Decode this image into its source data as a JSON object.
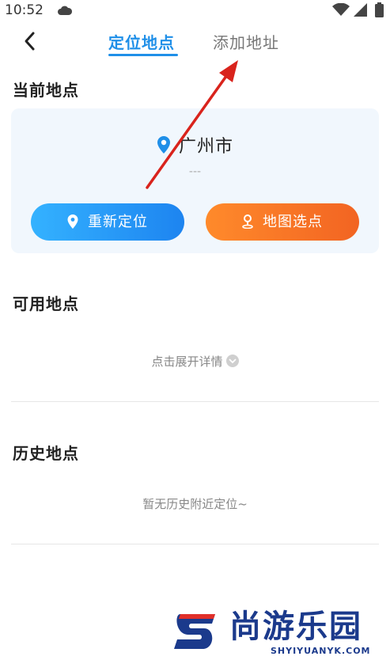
{
  "status_bar": {
    "time": "10:52"
  },
  "nav": {
    "tabs": [
      {
        "label": "定位地点",
        "active": true
      },
      {
        "label": "添加地址",
        "active": false
      }
    ]
  },
  "current": {
    "title": "当前地点",
    "city": "广州市",
    "sub": "---",
    "relocate_label": "重新定位",
    "map_pick_label": "地图选点"
  },
  "available": {
    "title": "可用地点",
    "expand_hint": "点击展开详情"
  },
  "history": {
    "title": "历史地点",
    "empty_hint": "暂无历史附近定位~"
  },
  "watermark": {
    "cn": "尚游乐园",
    "en": "SHYIYUANYK.COM"
  },
  "colors": {
    "accent": "#1f8fe8",
    "orange": "#f26422",
    "annotation_arrow": "#d9231c"
  }
}
